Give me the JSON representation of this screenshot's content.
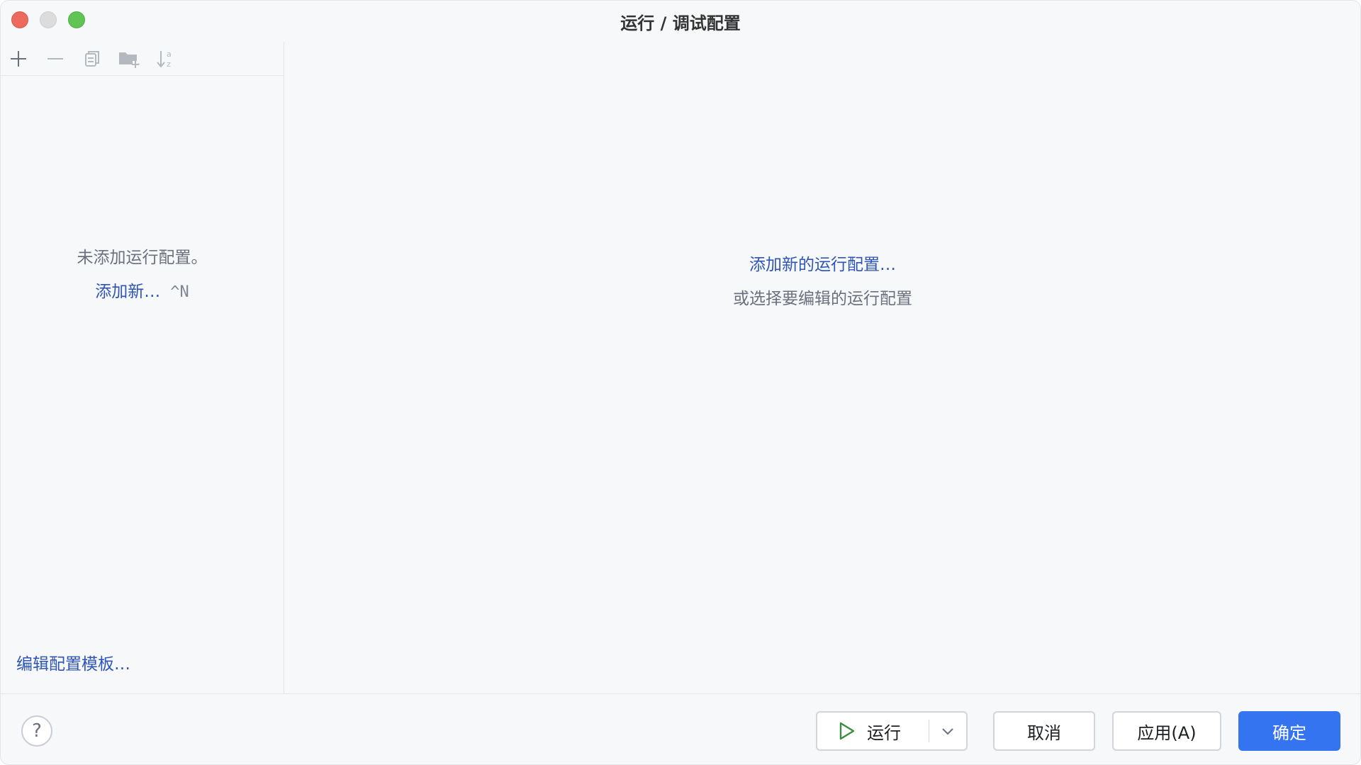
{
  "window": {
    "title": "运行 / 调试配置"
  },
  "toolbar": {
    "icons": [
      "add-icon",
      "remove-icon",
      "copy-icon",
      "new-folder-icon",
      "sort-alpha-icon"
    ]
  },
  "left_panel": {
    "empty_message": "未添加运行配置。",
    "add_new_link": "添加新…",
    "add_new_shortcut": "^N",
    "edit_templates_link": "编辑配置模板…"
  },
  "right_panel": {
    "add_new_config_link": "添加新的运行配置…",
    "or_select_text": "或选择要编辑的运行配置"
  },
  "buttons": {
    "help": "?",
    "run": "运行",
    "cancel": "取消",
    "apply": "应用(A)",
    "ok": "确定"
  },
  "colors": {
    "link": "#2e55b5",
    "primary_button": "#3574f0",
    "run_icon": "#3d8c40"
  }
}
